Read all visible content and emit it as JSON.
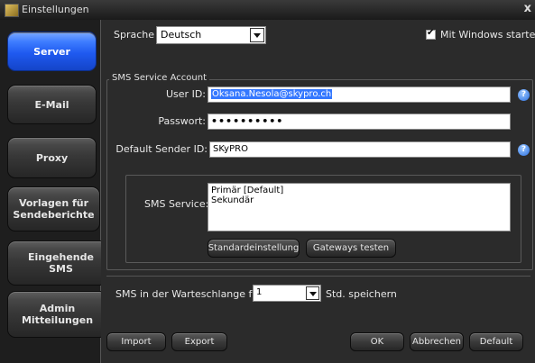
{
  "window": {
    "title": "Einstellungen",
    "close_icon": "close-icon"
  },
  "sidebar": {
    "items": [
      {
        "label": "Server",
        "active": true
      },
      {
        "label": "E-Mail",
        "active": false
      },
      {
        "label": "Proxy",
        "active": false
      },
      {
        "label": "Vorlagen für Sendeberichte",
        "active": false
      },
      {
        "label": "Eingehende SMS",
        "active": false
      },
      {
        "label": "Admin Mitteilungen",
        "active": false
      }
    ],
    "active_color": "#2a63f0"
  },
  "general": {
    "language_label": "Sprache",
    "language_value": "Deutsch",
    "start_with_windows_label": "Mit Windows starten",
    "start_with_windows_checked": true
  },
  "sms_account": {
    "group_title": "SMS Service Account",
    "user_id_label": "User ID:",
    "user_id_value": "Oksana.Nesola@skypro.ch",
    "password_label": "Passwort:",
    "password_value": "••••••••••",
    "sender_id_label": "Default Sender ID:",
    "sender_id_value": "SKyPRO",
    "sms_service_label": "SMS Service:",
    "sms_service_options": [
      "Primär [Default]",
      "Sekundär"
    ],
    "default_settings_button": "Standardeinstellung",
    "test_gateways_button": "Gateways testen"
  },
  "queue": {
    "label_before": "SMS in der Warteschlange für",
    "value": "1",
    "label_after": "Std. speichern"
  },
  "footer": {
    "import": "Import",
    "export": "Export",
    "ok": "OK",
    "cancel": "Abbrechen",
    "default": "Default"
  }
}
